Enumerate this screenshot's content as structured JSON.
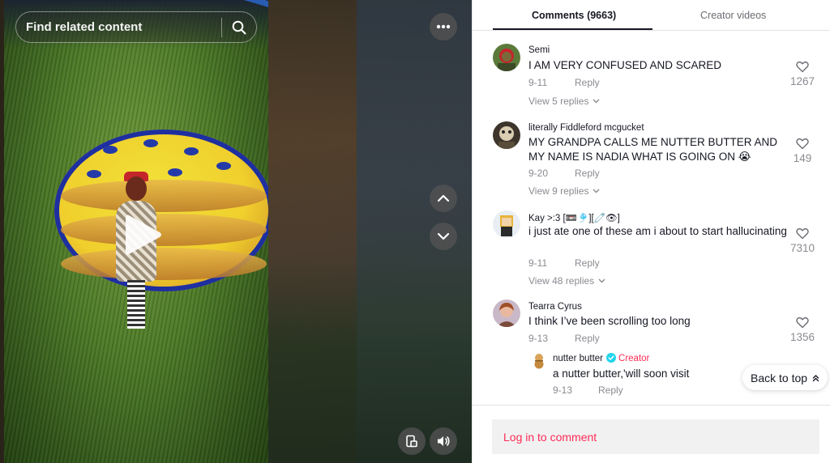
{
  "search": {
    "placeholder": "Find related content"
  },
  "tabs": {
    "comments": "Comments (9663)",
    "creator_videos": "Creator videos"
  },
  "comments": [
    {
      "user": "Semi",
      "text": "I AM VERY CONFUSED AND SCARED",
      "date": "9-11",
      "reply": "Reply",
      "likes": "1267",
      "view_replies": "View 5 replies"
    },
    {
      "user": "literally Fiddleford mcgucket",
      "text": "MY GRANDPA CALLS ME NUTTER BUTTER AND MY NAME IS NADIA WHAT IS GOING ON 😭",
      "date": "9-20",
      "reply": "Reply",
      "likes": "149",
      "view_replies": "View 9 replies"
    },
    {
      "user": "Kay >:3 [📼🎐][🧷👁]",
      "text": "i just ate one of these am i about to start hallucinating",
      "date": "9-11",
      "reply": "Reply",
      "likes": "7310",
      "view_replies": "View 48 replies"
    },
    {
      "user": "Tearra Cyrus",
      "text": "I think I’ve been scrolling too long",
      "date": "9-13",
      "reply": "Reply",
      "likes": "1356"
    }
  ],
  "creator_reply": {
    "user": "nutter butter",
    "tag": "Creator",
    "text": "a nutter butter,'will soon visit",
    "date": "9-13",
    "reply": "Reply"
  },
  "back_to_top": "Back to top",
  "login": "Log in to comment",
  "icons": {
    "search": "search-icon",
    "more": "more-icon",
    "prev": "chevron-up-icon",
    "next": "chevron-down-icon",
    "pip": "pip-icon",
    "volume": "volume-icon",
    "play": "play-icon",
    "heart": "heart-icon",
    "verified": "verified-icon"
  },
  "colors": {
    "accent": "#fe2c55",
    "verified": "#20d5ec",
    "text": "#161823",
    "muted": "#8a8b91"
  }
}
